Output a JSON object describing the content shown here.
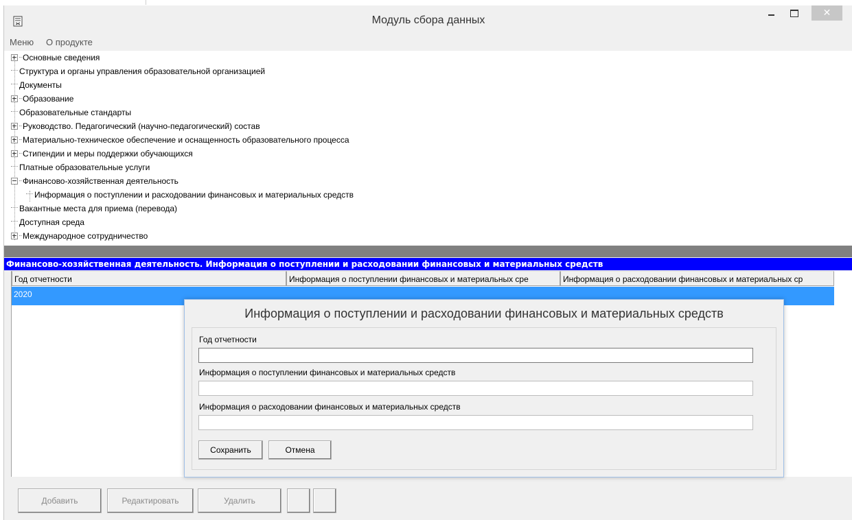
{
  "window": {
    "title": "Модуль сбора данных",
    "close_glyph": "✕"
  },
  "menu": {
    "items": [
      "Меню",
      "О продукте"
    ]
  },
  "tree": {
    "items": [
      {
        "label": "Основные сведения",
        "expander": "plus"
      },
      {
        "label": "Структура и органы управления образовательной организацией",
        "expander": "none"
      },
      {
        "label": "Документы",
        "expander": "none"
      },
      {
        "label": "Образование",
        "expander": "plus"
      },
      {
        "label": "Образовательные стандарты",
        "expander": "none"
      },
      {
        "label": "Руководство. Педагогический (научно-педагогический) состав",
        "expander": "plus"
      },
      {
        "label": "Материально-техническое обеспечение и оснащенность образовательного процесса",
        "expander": "plus"
      },
      {
        "label": "Стипендии и меры поддержки обучающихся",
        "expander": "plus"
      },
      {
        "label": "Платные образовательные услуги",
        "expander": "none"
      },
      {
        "label": "Финансово-хозяйственная деятельность",
        "expander": "minus"
      },
      {
        "label": "Информация о поступлении и расходовании финансовых и материальных средств",
        "expander": "child"
      },
      {
        "label": "Вакантные места для приема (перевода)",
        "expander": "none"
      },
      {
        "label": "Доступная среда",
        "expander": "none"
      },
      {
        "label": "Международное сотрудничество",
        "expander": "plus"
      }
    ]
  },
  "section": {
    "header": "Финансово-хозяйственная деятельность. Информация о поступлении и расходовании финансовых и материальных средств"
  },
  "grid": {
    "columns": [
      "Год отчетности",
      "Информация о поступлении финансовых и материальных сре",
      "Информация о расходовании финансовых и материальных ср"
    ],
    "rows": [
      [
        "2020",
        "",
        ""
      ]
    ]
  },
  "dialog": {
    "title": "Информация о поступлении и расходовании финансовых и материальных средств",
    "fields": [
      {
        "label": "Год отчетности",
        "value": ""
      },
      {
        "label": "Информация о поступлении финансовых и материальных средств",
        "value": ""
      },
      {
        "label": "Информация о расходовании финансовых и материальных средств",
        "value": ""
      }
    ],
    "save_label": "Сохранить",
    "cancel_label": "Отмена"
  },
  "toolbar": {
    "add_label": "Добавить",
    "edit_label": "Редактировать",
    "delete_label": "Удалить"
  },
  "colors": {
    "section_header_bg": "#0000ff",
    "selected_row_bg": "#3399ff",
    "splitter": "#808080"
  }
}
